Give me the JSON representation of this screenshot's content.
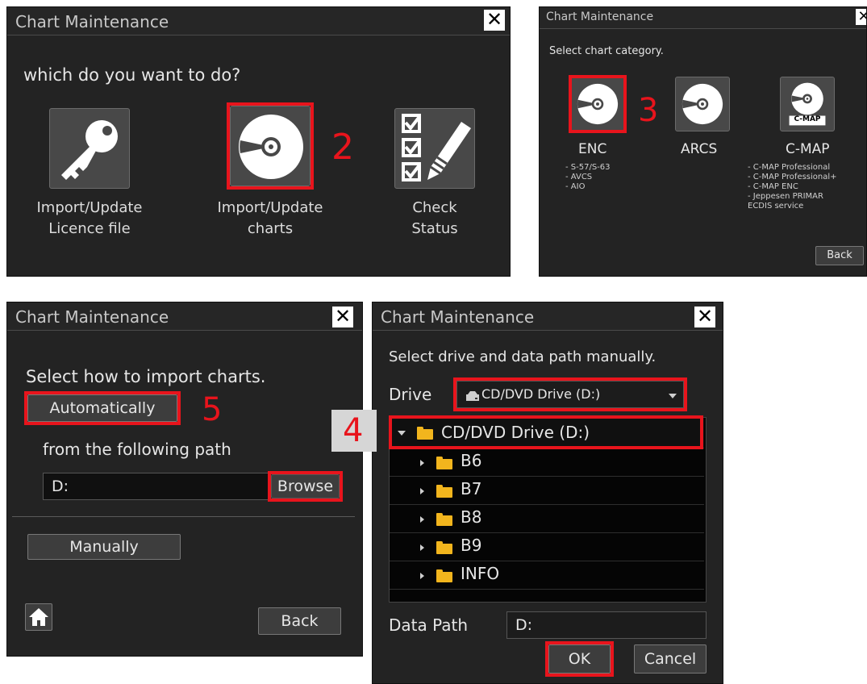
{
  "panel1": {
    "title": "Chart Maintenance",
    "close": "✕",
    "prompt": "which do you want to do?",
    "options": [
      {
        "icon": "key-icon",
        "line1": "Import/Update",
        "line2": "Licence file"
      },
      {
        "icon": "disc-icon",
        "line1": "Import/Update",
        "line2": "charts"
      },
      {
        "icon": "checklist-pencil-icon",
        "line1": "Check",
        "line2": "Status"
      }
    ],
    "step": "2"
  },
  "panel2": {
    "title": "Chart Maintenance",
    "close": "✕",
    "prompt": "Select chart category.",
    "categories": [
      {
        "name": "ENC",
        "notes": [
          "- S-57/S-63",
          "- AVCS",
          "- AIO"
        ]
      },
      {
        "name": "ARCS",
        "notes": []
      },
      {
        "name": "C-MAP",
        "badge": "C-MAP",
        "notes": [
          "- C-MAP Professional",
          "- C-MAP Professional+",
          "- C-MAP ENC",
          "- Jeppesen PRIMAR",
          "ECDIS service"
        ]
      }
    ],
    "back": "Back",
    "step": "3"
  },
  "panel3": {
    "title": "Chart Maintenance",
    "close": "✕",
    "prompt": "Select how to import charts.",
    "automatic": "Automatically",
    "path_label": "from the following path",
    "path_value": "D:",
    "browse": "Browse",
    "manual": "Manually",
    "back": "Back",
    "step": "5"
  },
  "panel4": {
    "title": "Chart Maintenance",
    "close": "✕",
    "prompt": "Select drive and data path manually.",
    "drive_label": "Drive",
    "drive_value": "CD/DVD Drive (D:)",
    "tree_root": "CD/DVD Drive (D:)",
    "folders": [
      "B6",
      "B7",
      "B8",
      "B9",
      "INFO"
    ],
    "data_path_label": "Data Path",
    "data_path_value": "D:",
    "ok": "OK",
    "cancel": "Cancel",
    "step": "4"
  },
  "colors": {
    "annotation": "#e8141c",
    "panel_bg": "#232323",
    "folder": "#f2b51d"
  }
}
